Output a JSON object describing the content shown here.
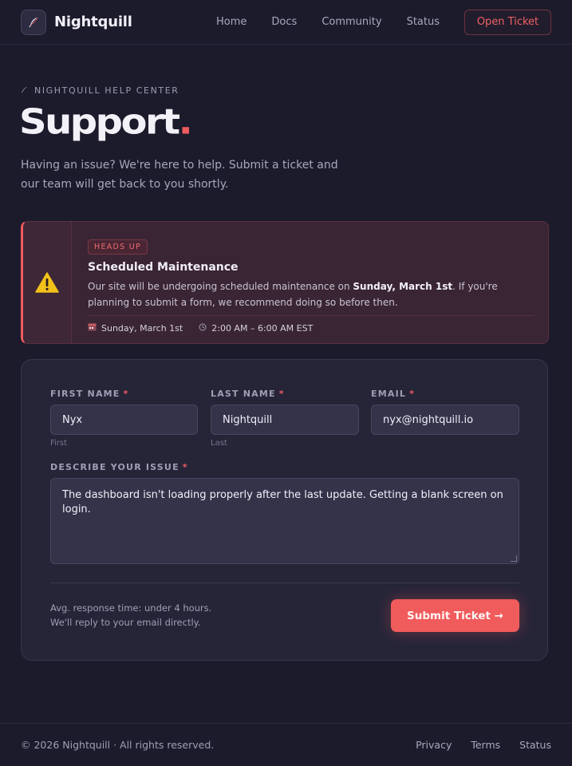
{
  "nav": {
    "brand": "Nightquill",
    "logo_icon": "quill-icon",
    "links": [
      "Home",
      "Docs",
      "Community",
      "Status"
    ],
    "cta": "Open Ticket"
  },
  "hero": {
    "eyebrow": "NIGHTQUILL HELP CENTER",
    "title": "Support",
    "title_dot": ".",
    "subtitle": "Having an issue? We're here to help. Submit a ticket and our team will get back to you shortly."
  },
  "alert": {
    "badge": "HEADS UP",
    "title": "Scheduled Maintenance",
    "body_pre": "Our site will be undergoing scheduled maintenance on ",
    "body_bold": "Sunday, March 1st",
    "body_post": ". If you're planning to submit a form, we recommend doing so before then.",
    "date": "Sunday, March 1st",
    "time": "2:00 AM – 6:00 AM EST",
    "icon": "warning-icon",
    "accent": "#ef5b5f"
  },
  "form": {
    "first_name": {
      "label": "FIRST NAME",
      "required": "*",
      "value": "Nyx",
      "hint": "First"
    },
    "last_name": {
      "label": "LAST NAME",
      "required": "*",
      "value": "Nightquill",
      "hint": "Last"
    },
    "email": {
      "label": "EMAIL",
      "required": "*",
      "value": "nyx@nightquill.io"
    },
    "issue": {
      "label": "DESCRIBE YOUR ISSUE",
      "required": "*",
      "value": "The dashboard isn't loading properly after the last update. Getting a blank screen on login."
    },
    "response_line1": "Avg. response time: under 4 hours.",
    "response_line2": "We'll reply to your email directly.",
    "submit": "Submit Ticket →"
  },
  "footer": {
    "copyright": "© 2026 Nightquill · All rights reserved.",
    "links": [
      "Privacy",
      "Terms",
      "Status"
    ]
  },
  "colors": {
    "background": "#1c1b2b",
    "accent": "#f05b5c",
    "card": "#262538"
  }
}
